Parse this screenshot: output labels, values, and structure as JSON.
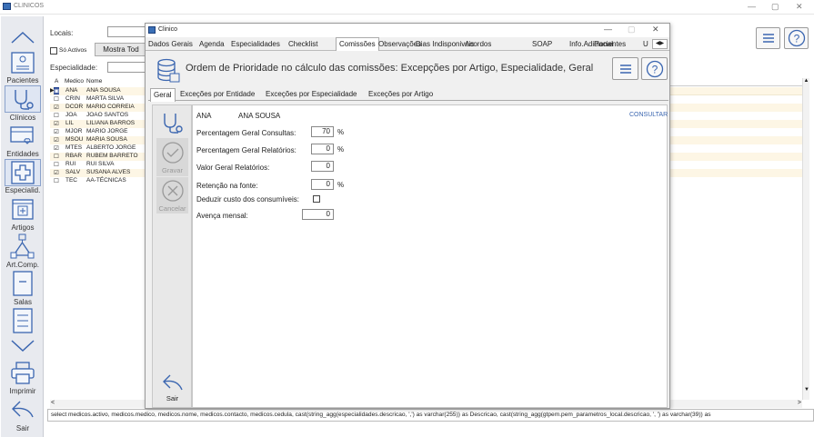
{
  "window": {
    "title": "CLINICOS",
    "minimize": "—",
    "maximize": "▢",
    "close": "✕"
  },
  "sidebar": {
    "items": [
      {
        "label": "",
        "icon": "chevron-up-icon"
      },
      {
        "label": "Pacientes",
        "icon": "patient-card-icon"
      },
      {
        "label": "Clínicos",
        "icon": "stethoscope-icon"
      },
      {
        "label": "Entidades",
        "icon": "card-heart-icon"
      },
      {
        "label": "Especialid.",
        "icon": "medical-cross-icon"
      },
      {
        "label": "Artigos",
        "icon": "calendar-plus-icon"
      },
      {
        "label": "Art.Comp.",
        "icon": "hierarchy-icon"
      },
      {
        "label": "Salas",
        "icon": "door-icon"
      },
      {
        "label": "",
        "icon": "checklist-icon"
      },
      {
        "label": "",
        "icon": "chevron-down-icon"
      },
      {
        "label": "Imprimir",
        "icon": "printer-icon"
      },
      {
        "label": "Sair",
        "icon": "back-arrow-icon"
      }
    ]
  },
  "main": {
    "locais_label": "Locais:",
    "so_activos_label": "Só Activos",
    "mostra_todos_label": "Mostra Tod",
    "especialidade_label": "Especialidade:",
    "grid_headers": {
      "a": "A",
      "medico": "Medico",
      "nome": "Nome"
    },
    "rows": [
      {
        "a": "▣",
        "medico": "ANA",
        "nome": "ANA SOUSA"
      },
      {
        "a": "☐",
        "medico": "CRIN",
        "nome": "MARTA SILVA"
      },
      {
        "a": "☑",
        "medico": "DCOR",
        "nome": "MARIO CORREIA"
      },
      {
        "a": "☐",
        "medico": "JOA",
        "nome": "JOAO SANTOS"
      },
      {
        "a": "☑",
        "medico": "LIL",
        "nome": "LILIANA BARROS"
      },
      {
        "a": "☑",
        "medico": "MJOR",
        "nome": "MARIO JORGE"
      },
      {
        "a": "☑",
        "medico": "MSOU",
        "nome": "MARIA SOUSA"
      },
      {
        "a": "☑",
        "medico": "MTES",
        "nome": "ALBERTO JORGE"
      },
      {
        "a": "☐",
        "medico": "RBAR",
        "nome": "RUBEM BARRETO"
      },
      {
        "a": "☐",
        "medico": "RUI",
        "nome": "RUI SILVA"
      },
      {
        "a": "☑",
        "medico": "SALV",
        "nome": "SUSANA ALVES"
      },
      {
        "a": "☐",
        "medico": "TEC",
        "nome": "AA-TÉCNICAS"
      }
    ],
    "status_sql": "select  medicos.activo, medicos.medico, medicos.nome, medicos.contacto, medicos.cedula,  cast(string_agg(especialidades.descricao, ',') as varchar(255)) as Descricao,  cast(string_agg(gtpem.pem_parametros_local.descricao, ', ') as varchar(39)) as"
  },
  "dialog": {
    "title": "Clinico",
    "tabs": [
      "Dados Gerais",
      "Agenda",
      "Especialidades",
      "Checklist",
      "Comissões",
      "Observações",
      "Dias Indisponiveis",
      "Acordos",
      "SOAP",
      "Info.Adicional",
      "Pacientes",
      "U"
    ],
    "active_tab": "Comissões",
    "header_title": "Ordem de Prioridade no cálculo das comissões: Excepções por Artigo, Especialidade, Geral",
    "subtabs": [
      "Geral",
      "Exceções por Entidade",
      "Exceções por Especialidade",
      "Exceções por Artigo"
    ],
    "gravar_label": "Gravar",
    "cancelar_label": "Cancelar",
    "sair_label": "Sair",
    "medico_code": "ANA",
    "medico_nome": "ANA SOUSA",
    "consultar_label": "CONSULTAR",
    "fields": {
      "pct_consultas": {
        "label": "Percentagem Geral Consultas:",
        "value": "70",
        "unit": "%"
      },
      "pct_relatorios": {
        "label": "Percentagem Geral Relatórios:",
        "value": "0",
        "unit": "%"
      },
      "valor_relatorios": {
        "label": "Valor Geral Relatórios:",
        "value": "0"
      },
      "retencao": {
        "label": "Retenção na fonte:",
        "value": "0",
        "unit": "%"
      },
      "deduzir": {
        "label": "Deduzir custo dos consumíveis:"
      },
      "avenca": {
        "label": "Avença mensal:",
        "value": "0"
      }
    }
  },
  "colors": {
    "accent": "#3b66b0",
    "sidebar_bg": "#e8eaef",
    "selected_row": "#1f3f8f"
  }
}
